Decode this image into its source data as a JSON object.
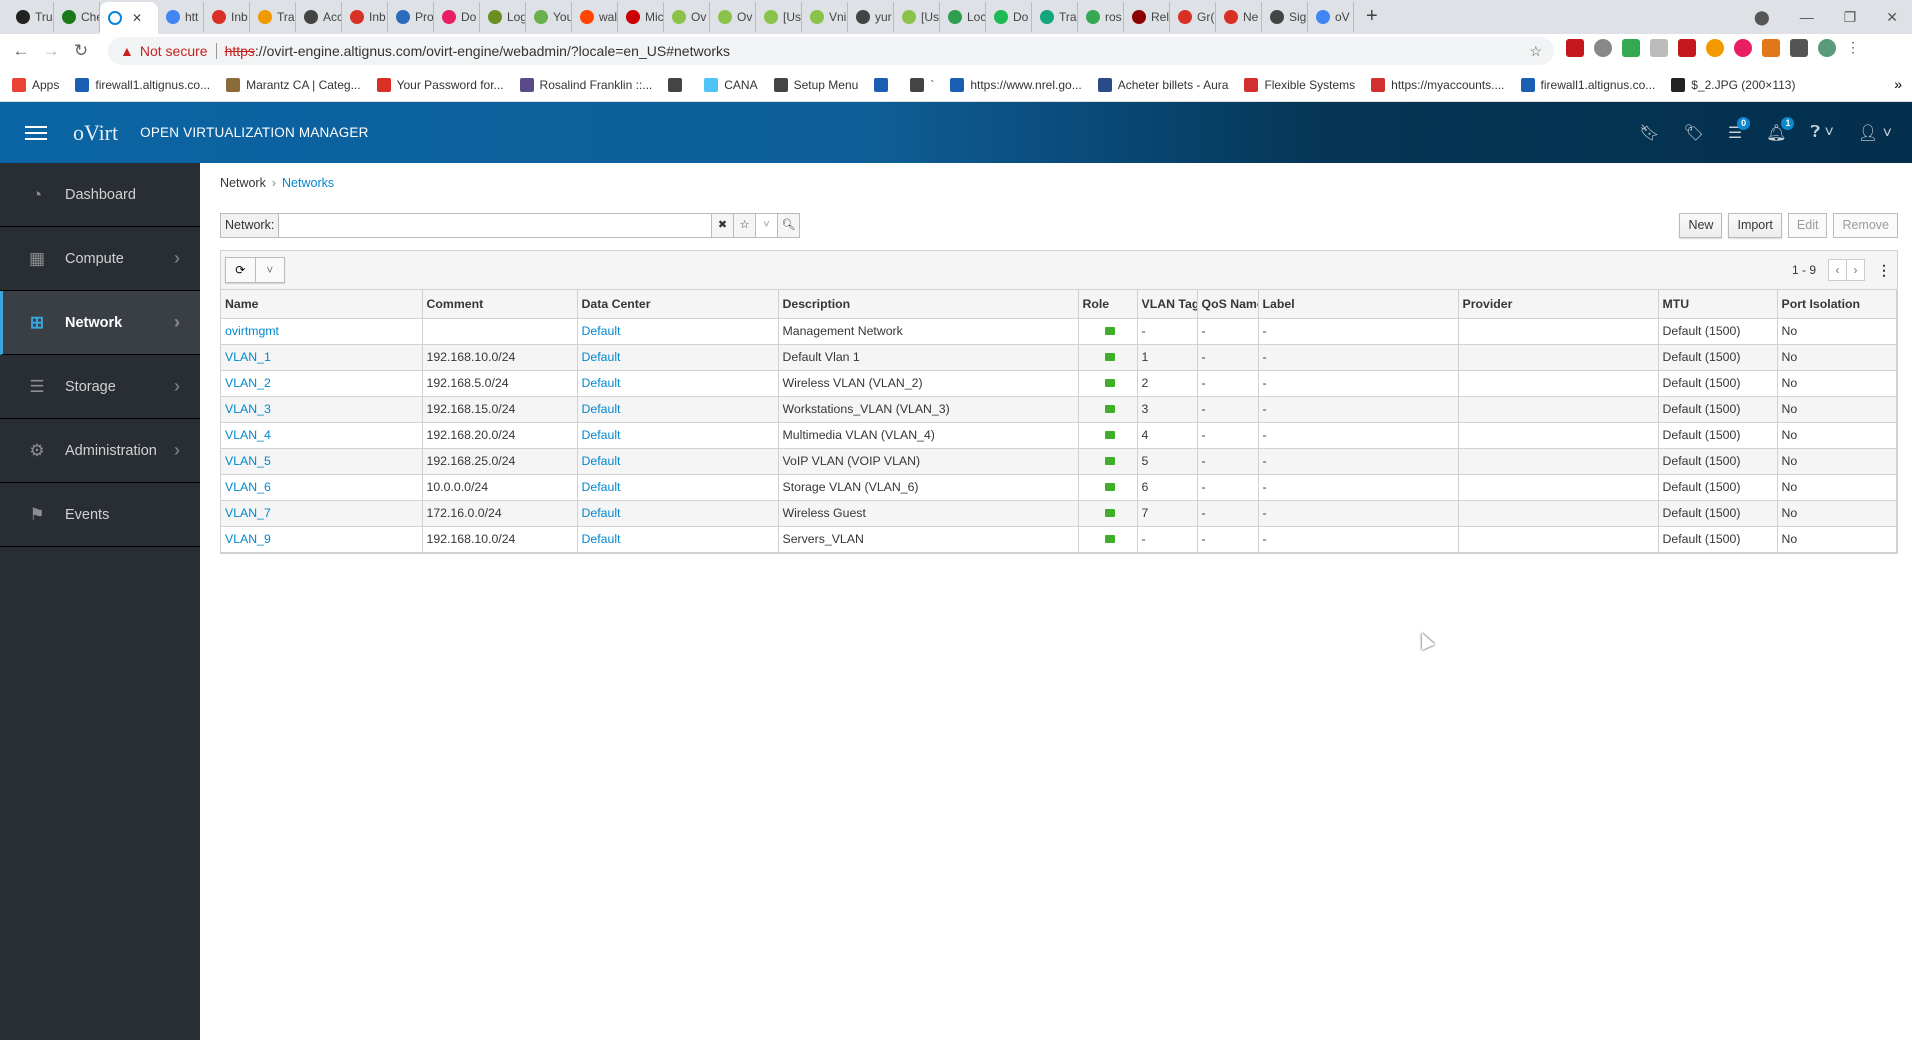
{
  "browser": {
    "tabs": [
      "Tru",
      "Che",
      "",
      "htt",
      "Inb",
      "Tra",
      "Acc",
      "Inb",
      "Pro",
      "Do",
      "Log",
      "You",
      "wal",
      "Mic",
      "Ov",
      "Ov",
      "[Us",
      "Vni",
      "yur",
      "[Us",
      "Loc",
      "Do",
      "Tra",
      "ros",
      "Rel",
      "Gr(",
      "Ne",
      "Sig",
      "oV"
    ],
    "tab_colors": [
      "#222",
      "#1a7a1a",
      "#0a84d6",
      "#4285f4",
      "#d93025",
      "#f29900",
      "#444",
      "#d93025",
      "#2a6dbf",
      "#e91e63",
      "#6b8e23",
      "#6ab04c",
      "#ff4500",
      "#c00",
      "#8bc34a",
      "#8bc34a",
      "#8bc34a",
      "#8bc34a",
      "#444",
      "#8bc34a",
      "#2e9e4f",
      "#1db954",
      "#12a67a",
      "#34a853",
      "#8b0000",
      "#d93025",
      "#d93025",
      "#444",
      "#4285f4"
    ],
    "new_tab": "+",
    "security_label": "Not secure",
    "url_scheme": "https",
    "url_rest": "://ovirt-engine.altignus.com/ovirt-engine/webadmin/?locale=en_US#networks",
    "bookmarks": [
      "Apps",
      "firewall1.altignus.co...",
      "Marantz CA | Categ...",
      "Your Password for...",
      "Rosalind Franklin ::...",
      "",
      "CANA",
      "Setup Menu",
      "",
      "`",
      "https://www.nrel.go...",
      "Acheter billets - Aura",
      "Flexible Systems",
      "https://myaccounts....",
      "firewall1.altignus.co...",
      "$_2.JPG (200×113)"
    ],
    "more": "»"
  },
  "header": {
    "logo": "oVirt",
    "title": "OPEN VIRTUALIZATION MANAGER",
    "tasks_count": "0",
    "alerts_count": "1"
  },
  "sidebar": {
    "items": [
      {
        "label": "Dashboard",
        "icon": "dashboard-icon",
        "glyph": "◔",
        "chevron": false
      },
      {
        "label": "Compute",
        "icon": "chip-icon",
        "glyph": "▦",
        "chevron": true
      },
      {
        "label": "Network",
        "icon": "network-icon",
        "glyph": "⊞",
        "chevron": true,
        "active": true
      },
      {
        "label": "Storage",
        "icon": "database-icon",
        "glyph": "☰",
        "chevron": true
      },
      {
        "label": "Administration",
        "icon": "gear-icon",
        "glyph": "⚙",
        "chevron": true
      },
      {
        "label": "Events",
        "icon": "flag-icon",
        "glyph": "⚑",
        "chevron": false
      }
    ]
  },
  "breadcrumb": {
    "parent": "Network",
    "current": "Networks"
  },
  "search": {
    "label": "Network:",
    "value": ""
  },
  "actions": {
    "new": "New",
    "import": "Import",
    "edit": "Edit",
    "remove": "Remove"
  },
  "pager": {
    "range": "1 - 9"
  },
  "table": {
    "columns": [
      "Name",
      "Comment",
      "Data Center",
      "Description",
      "Role",
      "VLAN Tag",
      "QoS Name",
      "Label",
      "Provider",
      "MTU",
      "Port Isolation"
    ],
    "rows": [
      [
        "ovirtmgmt",
        "",
        "Default",
        "Management Network",
        "vm",
        "-",
        "-",
        "-",
        "",
        "Default (1500)",
        "No"
      ],
      [
        "VLAN_1",
        "192.168.10.0/24",
        "Default",
        "Default Vlan 1",
        "vm",
        "1",
        "-",
        "-",
        "",
        "Default (1500)",
        "No"
      ],
      [
        "VLAN_2",
        "192.168.5.0/24",
        "Default",
        "Wireless VLAN (VLAN_2)",
        "vm",
        "2",
        "-",
        "-",
        "",
        "Default (1500)",
        "No"
      ],
      [
        "VLAN_3",
        "192.168.15.0/24",
        "Default",
        "Workstations_VLAN (VLAN_3)",
        "vm",
        "3",
        "-",
        "-",
        "",
        "Default (1500)",
        "No"
      ],
      [
        "VLAN_4",
        "192.168.20.0/24",
        "Default",
        "Multimedia VLAN (VLAN_4)",
        "vm",
        "4",
        "-",
        "-",
        "",
        "Default (1500)",
        "No"
      ],
      [
        "VLAN_5",
        "192.168.25.0/24",
        "Default",
        "VoIP VLAN (VOIP VLAN)",
        "vm",
        "5",
        "-",
        "-",
        "",
        "Default (1500)",
        "No"
      ],
      [
        "VLAN_6",
        "10.0.0.0/24",
        "Default",
        "Storage VLAN (VLAN_6)",
        "vm",
        "6",
        "-",
        "-",
        "",
        "Default (1500)",
        "No"
      ],
      [
        "VLAN_7",
        "172.16.0.0/24",
        "Default",
        "Wireless Guest",
        "vm",
        "7",
        "-",
        "-",
        "",
        "Default (1500)",
        "No"
      ],
      [
        "VLAN_9",
        "192.168.10.0/24",
        "Default",
        "Servers_VLAN",
        "vm",
        "-",
        "-",
        "-",
        "",
        "Default (1500)",
        "No"
      ]
    ]
  },
  "colors": {
    "header": "#0b64a3",
    "sidebar": "#292e34",
    "accent": "#39a5dc",
    "link": "#0088ce",
    "role_vm": "#3fae29"
  }
}
